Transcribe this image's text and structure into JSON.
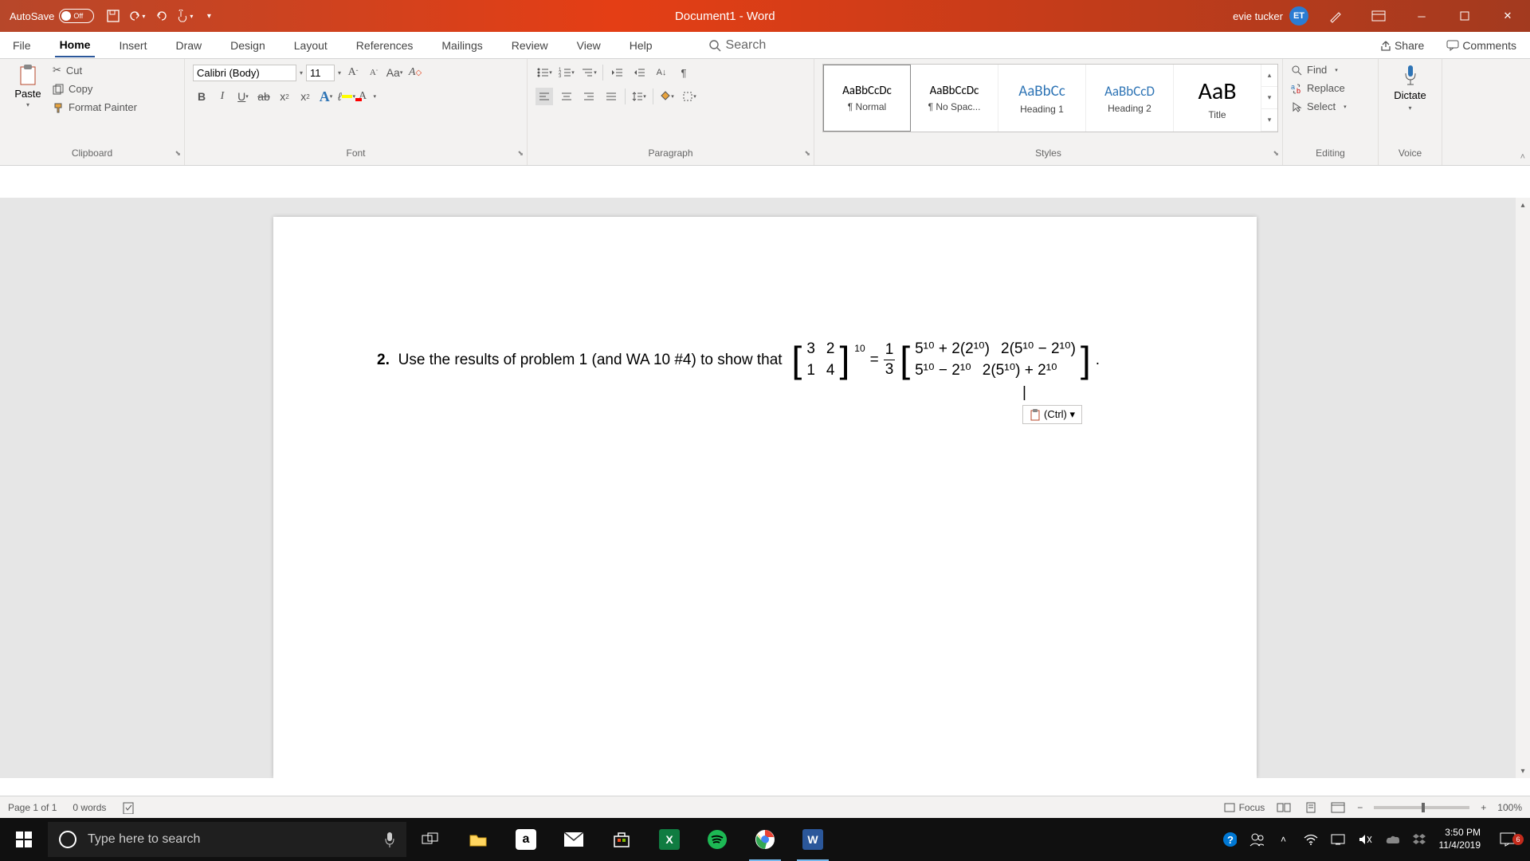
{
  "titlebar": {
    "autosave_label": "AutoSave",
    "autosave_state": "Off",
    "doc_title": "Document1 - Word",
    "user_name": "evie tucker",
    "user_initials": "ET"
  },
  "tabs": {
    "items": [
      "File",
      "Home",
      "Insert",
      "Draw",
      "Design",
      "Layout",
      "References",
      "Mailings",
      "Review",
      "View",
      "Help"
    ],
    "active_index": 1,
    "search_placeholder": "Search",
    "share": "Share",
    "comments": "Comments"
  },
  "ribbon": {
    "clipboard": {
      "paste": "Paste",
      "cut": "Cut",
      "copy": "Copy",
      "format_painter": "Format Painter",
      "label": "Clipboard"
    },
    "font": {
      "name": "Calibri (Body)",
      "size": "11",
      "label": "Font"
    },
    "paragraph": {
      "label": "Paragraph"
    },
    "styles": {
      "items": [
        {
          "sample": "AaBbCcDc",
          "name": "¶ Normal",
          "size": "15px"
        },
        {
          "sample": "AaBbCcDc",
          "name": "¶ No Spac...",
          "size": "15px"
        },
        {
          "sample": "AaBbCc",
          "name": "Heading 1",
          "size": "19px",
          "color": "#2e74b5"
        },
        {
          "sample": "AaBbCcD",
          "name": "Heading 2",
          "size": "17px",
          "color": "#2e74b5"
        },
        {
          "sample": "AaB",
          "name": "Title",
          "size": "30px"
        }
      ],
      "label": "Styles"
    },
    "editing": {
      "find": "Find",
      "replace": "Replace",
      "select": "Select",
      "label": "Editing"
    },
    "voice": {
      "dictate": "Dictate",
      "label": "Voice"
    }
  },
  "document": {
    "problem_number": "2.",
    "problem_text": "Use the results of problem 1 (and WA 10 #4) to show that",
    "matrix_left": [
      [
        "3",
        "2"
      ],
      [
        "1",
        "4"
      ]
    ],
    "matrix_exp": "10",
    "frac_num": "1",
    "frac_den": "3",
    "matrix_right": [
      [
        "5¹⁰ + 2(2¹⁰)",
        "2(5¹⁰ − 2¹⁰)"
      ],
      [
        "5¹⁰ − 2¹⁰",
        "2(5¹⁰) + 2¹⁰"
      ]
    ],
    "paste_tag": "(Ctrl) ▾"
  },
  "status": {
    "page": "Page 1 of 1",
    "words": "0 words",
    "focus": "Focus",
    "zoom": "100%"
  },
  "taskbar": {
    "search_placeholder": "Type here to search",
    "time": "3:50 PM",
    "date": "11/4/2019",
    "notif_count": "6"
  }
}
